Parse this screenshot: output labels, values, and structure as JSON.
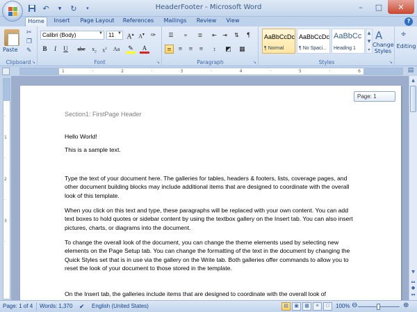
{
  "window": {
    "title": "HeaderFooter - Microsoft Word"
  },
  "quick_access": {
    "save_icon": "save-icon",
    "undo_icon": "undo-icon",
    "redo_icon": "redo-icon",
    "customize_icon": "customize-qat-icon"
  },
  "ribbon_tabs": [
    "Home",
    "Insert",
    "Page Layout",
    "References",
    "Mailings",
    "Review",
    "View"
  ],
  "ribbon": {
    "clipboard": {
      "label": "Clipboard",
      "paste_label": "Paste"
    },
    "font": {
      "label": "Font",
      "font_name": "Calibri (Body)",
      "font_size": "11"
    },
    "paragraph": {
      "label": "Paragraph"
    },
    "styles": {
      "label": "Styles",
      "items": [
        {
          "sample": "AaBbCcDc",
          "name": "¶ Normal"
        },
        {
          "sample": "AaBbCcDc",
          "name": "¶ No Spaci..."
        },
        {
          "sample": "AaBbCc",
          "name": "Heading 1"
        }
      ],
      "change_styles_label_1": "Change",
      "change_styles_label_2": "Styles"
    },
    "editing": {
      "label": "Editing"
    }
  },
  "document": {
    "header_text": "Section1: FirstPage Header",
    "page_tooltip": "Page: 1",
    "line1": "Hello World!",
    "line2": "This is a sample text.",
    "para1": "Type the text of your document here. The galleries for tables, headers & footers, lists, coverage pages, and other document building blocks may include additional items that are designed to coordinate with the overall look of this template.",
    "para2": "When you click on this text and type, these paragraphs will be replaced with your own content. You can add text boxes to hold quotes or sidebar content by using the textbox gallery on the Insert tab. You can also insert pictures, charts, or diagrams into the document.",
    "para3": "To change the overall look of the document, you can change the theme elements used by selecting new elements on the Page Setup tab. You can change the formatting of the text in the document   by changing the Quick Styles set that is in use via the gallery on the Write tab. Both galleries offer commands to allow you to reset the look of your document to those stored in the template.",
    "para4": "On the Insert tab, the galleries include items that are designed to coordinate with the overall look of"
  },
  "status": {
    "page": "Page: 1 of 4",
    "words": "Words: 1,370",
    "language": "English (United States)",
    "zoom": "100%"
  },
  "colors": {
    "accent": "#15428b",
    "ribbon_bg": "#dae6f5",
    "doc_bg": "#9caecb",
    "close_button": "#c9482f"
  }
}
